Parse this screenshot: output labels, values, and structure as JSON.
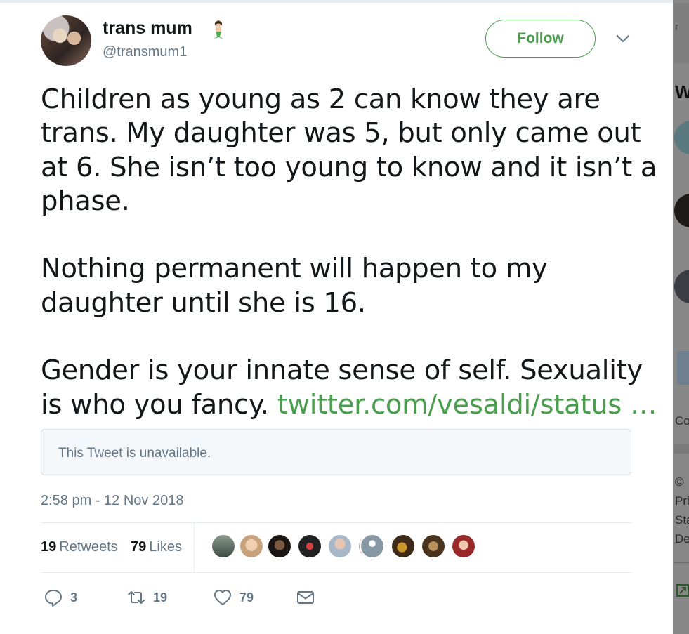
{
  "user": {
    "name": "trans mum",
    "name_emoji": "mermaid-icon",
    "handle": "@transmum1"
  },
  "follow_label": "Follow",
  "tweet": {
    "lines_p1": [
      "Children as young as 2 can know they are",
      "trans. My daughter was 5, but only came out",
      "at 6. She isn’t too young to know and it isn’t a",
      "phase."
    ],
    "lines_p2": [
      "Nothing permanent will happen to my",
      "daughter until she is 16."
    ],
    "line_p3a": "Gender is your innate sense of self. Sexuality",
    "line_p3b": "is who you fancy. ",
    "link": "twitter.com/vesaldi/status …"
  },
  "quote": {
    "text": "This Tweet is unavailable."
  },
  "timestamp": "2:58 pm - 12 Nov 2018",
  "stats": {
    "retweets_count": "19",
    "retweets_label": "Retweets",
    "likes_count": "79",
    "likes_label": "Likes"
  },
  "actions": {
    "reply_count": "3",
    "retweet_count": "19",
    "like_count": "79"
  },
  "sidebar_fragments": {
    "top": "r",
    "heading": "W",
    "co": "Co",
    "copyright": "©",
    "pri": "Pri",
    "sta": "Sta",
    "de": "De"
  },
  "colors": {
    "accent": "#4b9e4e",
    "secondary_text": "#657786",
    "primary_text": "#14171a"
  }
}
